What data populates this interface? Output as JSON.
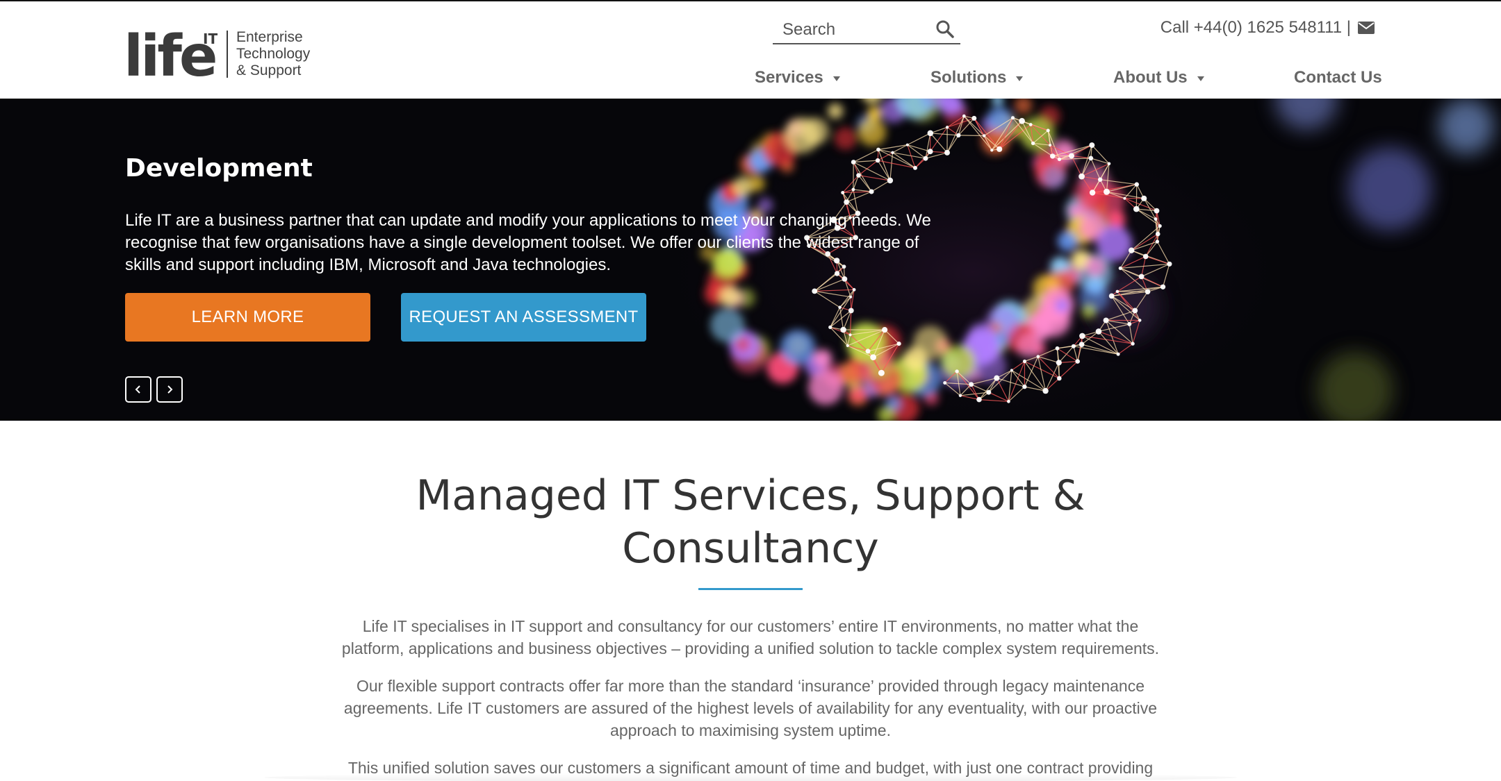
{
  "header": {
    "logo_text": "life",
    "logo_superscript": "IT",
    "tagline_lines": [
      "Enterprise",
      "Technology",
      "& Support"
    ],
    "search_placeholder": "Search",
    "contact_text": "Call +44(0) 1625 548111 |",
    "nav": [
      {
        "label": "Services",
        "has_dropdown": true
      },
      {
        "label": "Solutions",
        "has_dropdown": true
      },
      {
        "label": "About Us",
        "has_dropdown": true
      },
      {
        "label": "Contact Us",
        "has_dropdown": false
      }
    ]
  },
  "hero": {
    "title": "Development",
    "text": "Life IT are a business partner that can update and modify your applications to meet your changing needs. We recognise that few organisations have a single development toolset. We offer our clients the widest range of skills and support including IBM, Microsoft and Java technologies.",
    "learn_more_label": "LEARN MORE",
    "assessment_label": "REQUEST AN ASSESSMENT"
  },
  "main": {
    "heading_line1": "Managed IT Services, Support &",
    "heading_line2": "Consultancy",
    "paragraphs": [
      "Life IT specialises in IT support and consultancy for our customers’ entire IT environments, no matter what the platform, applications and business objectives – providing a unified solution to tackle complex system requirements.",
      "Our flexible support contracts offer far more than the standard ‘insurance’ provided through legacy maintenance agreements. Life IT customers are assured of the highest levels of availability for any eventuality, with our proactive approach to maximising system uptime.",
      "This unified solution saves our customers a significant amount of time and budget, with just one contract providing"
    ]
  },
  "colors": {
    "accent_orange": "#e87722",
    "accent_blue": "#3399cc",
    "text_dark": "#333333",
    "text_muted": "#666666"
  },
  "icons": {
    "search": "search-icon",
    "mail": "mail-icon",
    "caret": "caret-down-icon",
    "prev": "chevron-left-icon",
    "next": "chevron-right-icon"
  }
}
